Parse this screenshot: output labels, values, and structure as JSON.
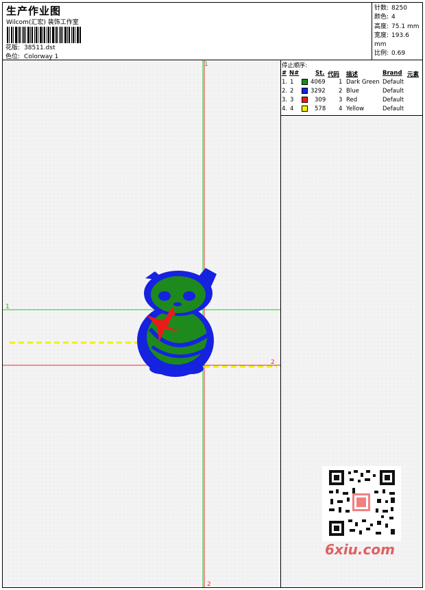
{
  "header": {
    "title": "生产作业图",
    "subtitle": "Wilcom(汇宏) 装饰工作室",
    "design_label": "花版:",
    "design_value": "38511.dst",
    "colorway_label": "色位:",
    "colorway_value": "Colorway 1"
  },
  "stats": {
    "stitches_label": "针数:",
    "stitches_value": "8250",
    "colors_label": "颜色:",
    "colors_value": "4",
    "height_label": "高度:",
    "height_value": "75.1 mm",
    "width_label": "宽度:",
    "width_value": "193.6 mm",
    "scale_label": "比例:",
    "scale_value": "0.69"
  },
  "stop_sequence": {
    "heading": "停止顺序:",
    "columns": [
      "#",
      "N#",
      "St.",
      "代码",
      "描述",
      "Brand",
      "元素"
    ],
    "rows": [
      {
        "num": "1.",
        "n": "1",
        "st": "4069",
        "code": "1",
        "desc": "Dark Green",
        "brand": "Default",
        "color": "#1e8a1e"
      },
      {
        "num": "2.",
        "n": "2",
        "st": "3292",
        "code": "2",
        "desc": "Blue",
        "brand": "Default",
        "color": "#1522e0"
      },
      {
        "num": "3.",
        "n": "3",
        "st": "309",
        "code": "3",
        "desc": "Red",
        "brand": "Default",
        "color": "#ee1a1a"
      },
      {
        "num": "4.",
        "n": "4",
        "st": "578",
        "code": "4",
        "desc": "Yellow",
        "brand": "Default",
        "color": "#f2f20a"
      }
    ]
  },
  "markers": {
    "top": "1",
    "left": "1",
    "right": "2",
    "bottom": "2"
  },
  "watermark": "6xiu.com"
}
